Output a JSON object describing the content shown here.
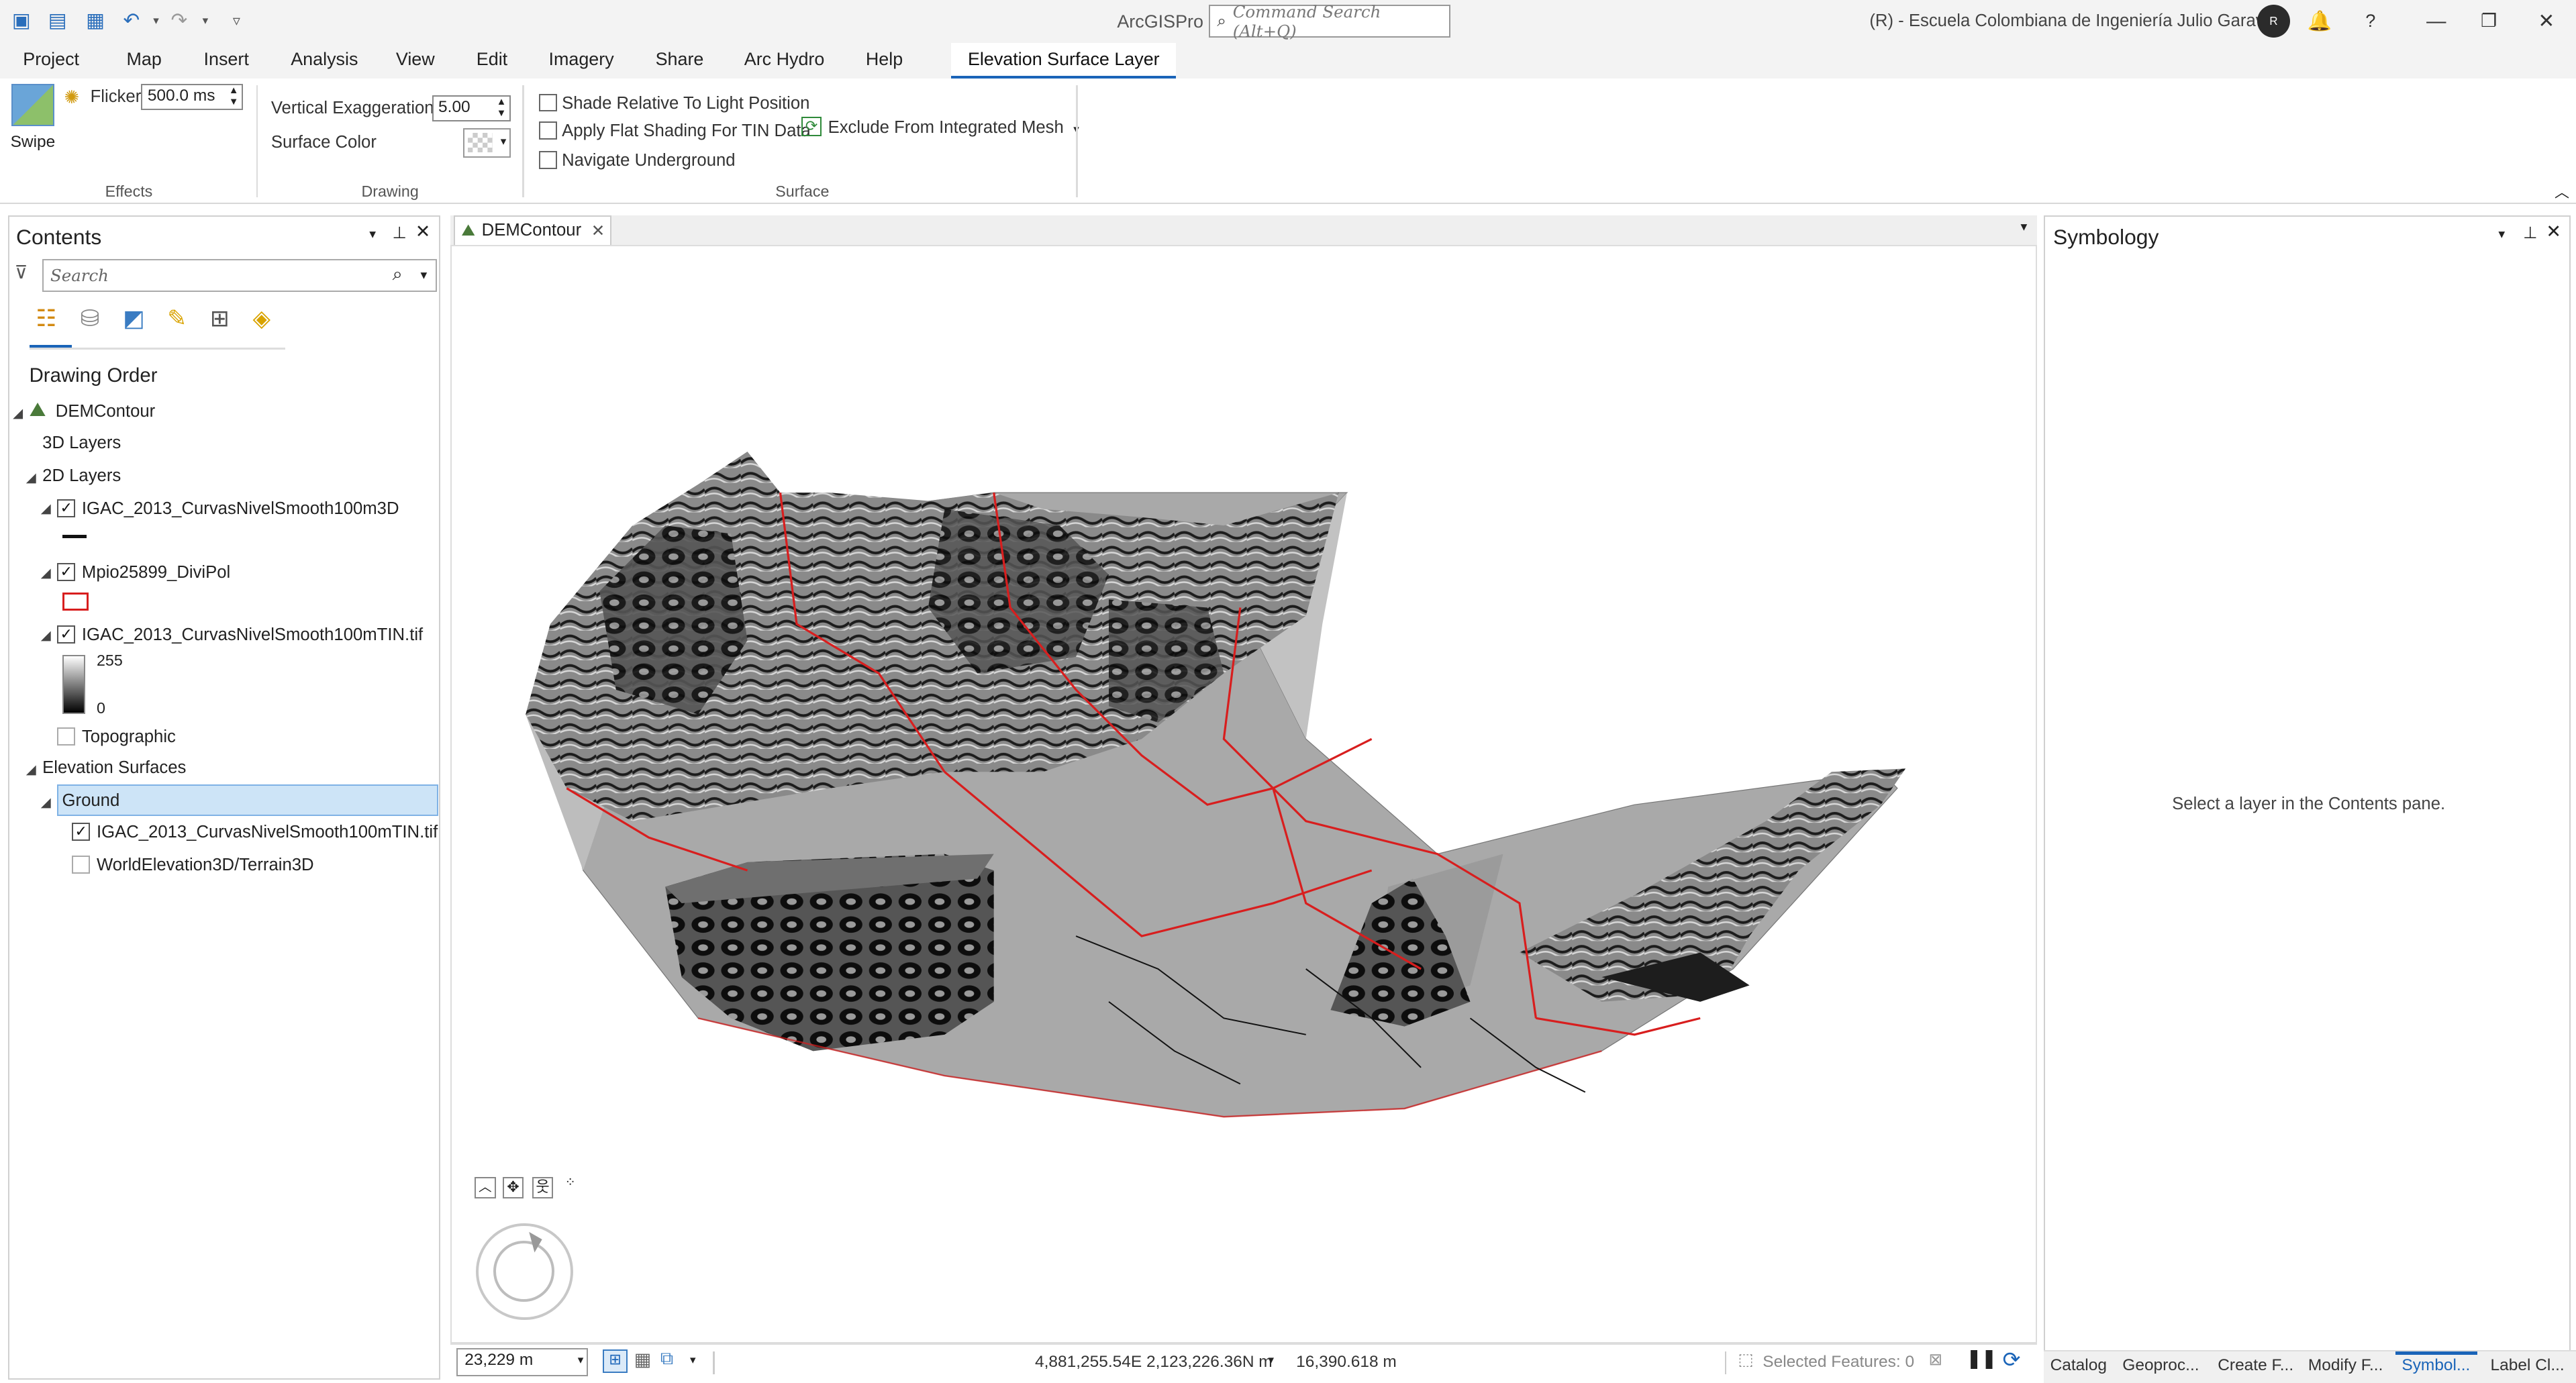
{
  "titlebar": {
    "app_name": "ArcGISPro",
    "command_search_placeholder": "Command Search (Alt+Q)",
    "org_name": "(R) - Escuela Colombiana de Ingeniería Julio Garavito",
    "avatar_initials": "R"
  },
  "ribbon_tabs": [
    "Project",
    "Map",
    "Insert",
    "Analysis",
    "View",
    "Edit",
    "Imagery",
    "Share",
    "Arc Hydro",
    "Help"
  ],
  "active_tab": "Elevation Surface Layer",
  "ribbon": {
    "effects": {
      "swipe_label": "Swipe",
      "flicker_label": "Flicker",
      "flicker_value": "500.0 ms",
      "group_label": "Effects"
    },
    "drawing": {
      "vertical_exaggeration_label": "Vertical Exaggeration",
      "vertical_exaggeration_value": "5.00",
      "surface_color_label": "Surface Color",
      "group_label": "Drawing"
    },
    "surface": {
      "shade_relative": "Shade Relative To Light Position",
      "flat_shading": "Apply Flat Shading For TIN Data",
      "exclude_mesh": "Exclude From Integrated Mesh",
      "navigate_underground": "Navigate Underground",
      "group_label": "Surface"
    }
  },
  "contents": {
    "title": "Contents",
    "search_placeholder": "Search",
    "drawing_order": "Drawing Order",
    "map_name": "DEMContour",
    "layers_3d": "3D Layers",
    "layers_2d": "2D Layers",
    "layer1": "IGAC_2013_CurvasNivelSmooth100m3D",
    "layer2": "Mpio25899_DiviPol",
    "layer3": "IGAC_2013_CurvasNivelSmooth100mTIN.tif",
    "legend_high": "255",
    "legend_low": "0",
    "topographic": "Topographic",
    "elevation_surfaces": "Elevation Surfaces",
    "ground": "Ground",
    "surface1": "IGAC_2013_CurvasNivelSmooth100mTIN.tif",
    "surface2": "WorldElevation3D/Terrain3D"
  },
  "map": {
    "tab_label": "DEMContour",
    "scale": "23,229 m",
    "coordinates": "4,881,255.54E 2,123,226.36N m",
    "distance": "16,390.618 m",
    "selected_features": "Selected Features: 0"
  },
  "symbology": {
    "title": "Symbology",
    "message": "Select a layer in the Contents pane."
  },
  "bottom_tabs": [
    "Catalog",
    "Geoproc...",
    "Create F...",
    "Modify F...",
    "Symbol...",
    "Label Cl..."
  ],
  "colors": {
    "accent": "#1a64b8",
    "boundary_red": "#d81e1e",
    "selection_bg": "#cde4f7"
  }
}
